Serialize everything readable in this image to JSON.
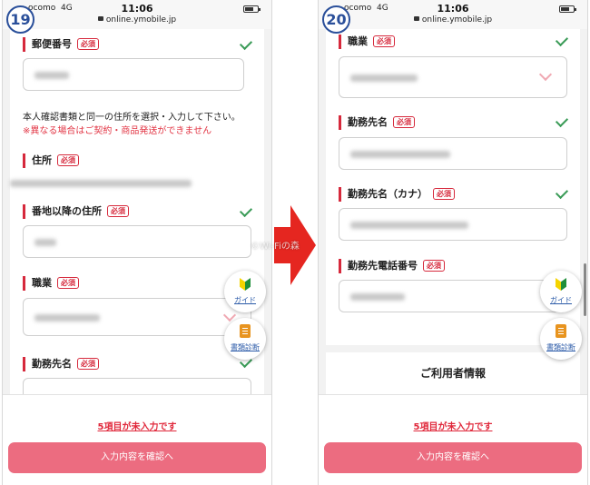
{
  "status_bar": {
    "carrier": "ocomo",
    "network": "4G",
    "time": "11:06",
    "url": "online.ymobile.jp"
  },
  "screens": [
    {
      "step": "19",
      "fields": {
        "postal_code": {
          "label": "郵便番号",
          "required": "必須"
        },
        "address": {
          "label": "住所",
          "required": "必須"
        },
        "address_detail": {
          "label": "番地以降の住所",
          "required": "必須"
        },
        "occupation": {
          "label": "職業",
          "required": "必須"
        },
        "employer": {
          "label": "勤務先名",
          "required": "必須"
        }
      },
      "note": "本人確認書類と同一の住所を選択・入力して下さい。",
      "warning": "※異なる場合はご契約・商品発送ができません"
    },
    {
      "step": "20",
      "fields": {
        "occupation": {
          "label": "職業",
          "required": "必須"
        },
        "employer": {
          "label": "勤務先名",
          "required": "必須"
        },
        "employer_kana": {
          "label": "勤務先名（カナ）",
          "required": "必須"
        },
        "employer_phone": {
          "label": "勤務先電話番号",
          "required": "必須"
        }
      },
      "section_title": "ご利用者情報"
    }
  ],
  "float_buttons": {
    "guide": "ガイド",
    "doc_check": "書類診断"
  },
  "footer": {
    "missing_link": "5項目が未入力です",
    "confirm_button": "入力内容を確認へ"
  },
  "watermark": "©Wi-Fiの森",
  "colors": {
    "required_red": "#d6293c",
    "button_pink": "#ec6c80",
    "check_green": "#3a9b57",
    "arrow_red": "#e52620",
    "badge_blue": "#2a4f9a"
  }
}
